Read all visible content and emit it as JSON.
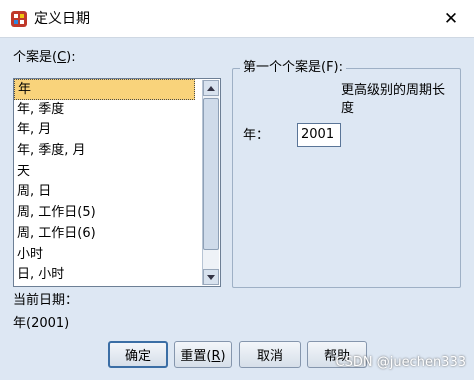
{
  "window": {
    "title": "定义日期",
    "close_glyph": "✕"
  },
  "cases_label": {
    "text": "个案是(",
    "mnemonic": "C",
    "end": "):"
  },
  "case_list": {
    "items": [
      "年",
      "年, 季度",
      "年, 月",
      "年, 季度, 月",
      "天",
      "周, 日",
      "周, 工作日(5)",
      "周, 工作日(6)",
      "小时",
      "日, 小时"
    ],
    "selected_index": 0
  },
  "current_date": {
    "label": "当前日期：",
    "value": "年(2001)"
  },
  "first_case": {
    "legend": "第一个个案是(F):",
    "higher_period_label": "更高级别的周期长度",
    "year_label": "年：",
    "year_value": "2001"
  },
  "buttons": {
    "ok": "确定",
    "reset": {
      "text": "重置(",
      "mnemonic": "R",
      "end": ")"
    },
    "cancel": "取消",
    "help": "帮助"
  },
  "watermark": "CSDN @juechen333",
  "colors": {
    "dialog_bg": "#dde7f3",
    "selection": "#f9d37b",
    "group_border": "#9eb0c5"
  },
  "icons": {
    "app": "spss-app-icon",
    "close": "close-icon",
    "scroll_up": "scroll-up-arrow-icon",
    "scroll_down": "scroll-down-arrow-icon"
  }
}
